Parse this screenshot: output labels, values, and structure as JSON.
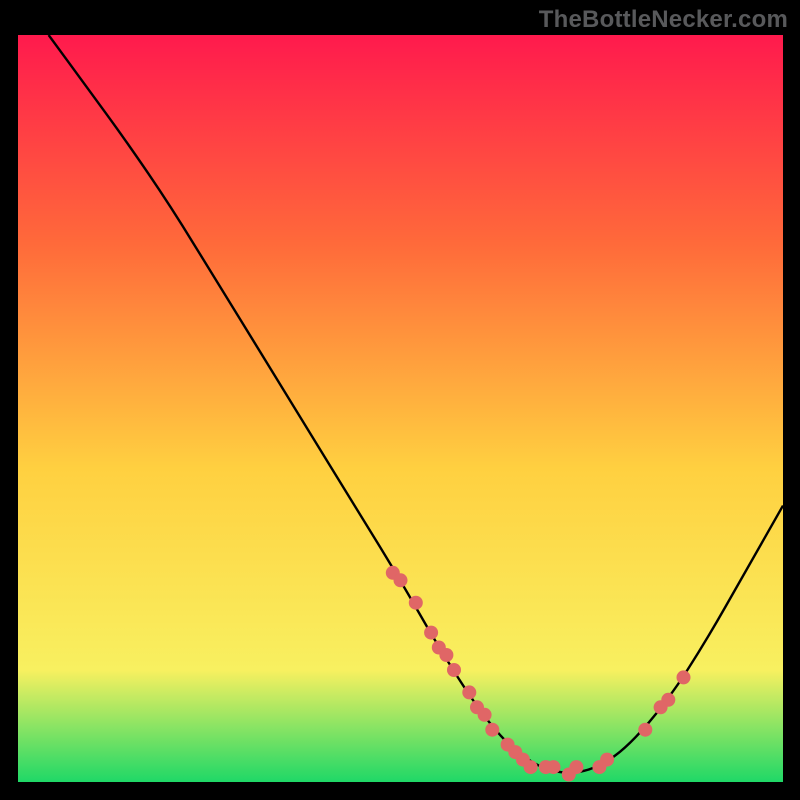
{
  "attribution": "TheBottleNecker.com",
  "colors": {
    "frame": "#000000",
    "gradient_top": "#ff1a4d",
    "gradient_mid1": "#ff6a3a",
    "gradient_mid2": "#ffd040",
    "gradient_mid3": "#f8f060",
    "gradient_bottom": "#1fd867",
    "curve": "#000000",
    "marker": "#e06666"
  },
  "chart_data": {
    "type": "line",
    "title": "",
    "xlabel": "",
    "ylabel": "",
    "xlim": [
      0,
      100
    ],
    "ylim": [
      0,
      100
    ],
    "curve": [
      {
        "x": 4,
        "y": 100
      },
      {
        "x": 9,
        "y": 93
      },
      {
        "x": 14,
        "y": 86
      },
      {
        "x": 20,
        "y": 77
      },
      {
        "x": 26,
        "y": 67
      },
      {
        "x": 32,
        "y": 57
      },
      {
        "x": 38,
        "y": 47
      },
      {
        "x": 44,
        "y": 37
      },
      {
        "x": 50,
        "y": 27
      },
      {
        "x": 55,
        "y": 18
      },
      {
        "x": 60,
        "y": 10
      },
      {
        "x": 64,
        "y": 5
      },
      {
        "x": 68,
        "y": 2
      },
      {
        "x": 72,
        "y": 1
      },
      {
        "x": 76,
        "y": 2
      },
      {
        "x": 80,
        "y": 5
      },
      {
        "x": 85,
        "y": 11
      },
      {
        "x": 90,
        "y": 19
      },
      {
        "x": 95,
        "y": 28
      },
      {
        "x": 100,
        "y": 37
      }
    ],
    "markers": [
      {
        "x": 49,
        "y": 28
      },
      {
        "x": 50,
        "y": 27
      },
      {
        "x": 52,
        "y": 24
      },
      {
        "x": 54,
        "y": 20
      },
      {
        "x": 55,
        "y": 18
      },
      {
        "x": 56,
        "y": 17
      },
      {
        "x": 57,
        "y": 15
      },
      {
        "x": 59,
        "y": 12
      },
      {
        "x": 60,
        "y": 10
      },
      {
        "x": 61,
        "y": 9
      },
      {
        "x": 62,
        "y": 7
      },
      {
        "x": 64,
        "y": 5
      },
      {
        "x": 65,
        "y": 4
      },
      {
        "x": 66,
        "y": 3
      },
      {
        "x": 67,
        "y": 2
      },
      {
        "x": 69,
        "y": 2
      },
      {
        "x": 70,
        "y": 2
      },
      {
        "x": 72,
        "y": 1
      },
      {
        "x": 73,
        "y": 2
      },
      {
        "x": 76,
        "y": 2
      },
      {
        "x": 77,
        "y": 3
      },
      {
        "x": 82,
        "y": 7
      },
      {
        "x": 84,
        "y": 10
      },
      {
        "x": 85,
        "y": 11
      },
      {
        "x": 87,
        "y": 14
      }
    ],
    "marker_radius": 7
  }
}
